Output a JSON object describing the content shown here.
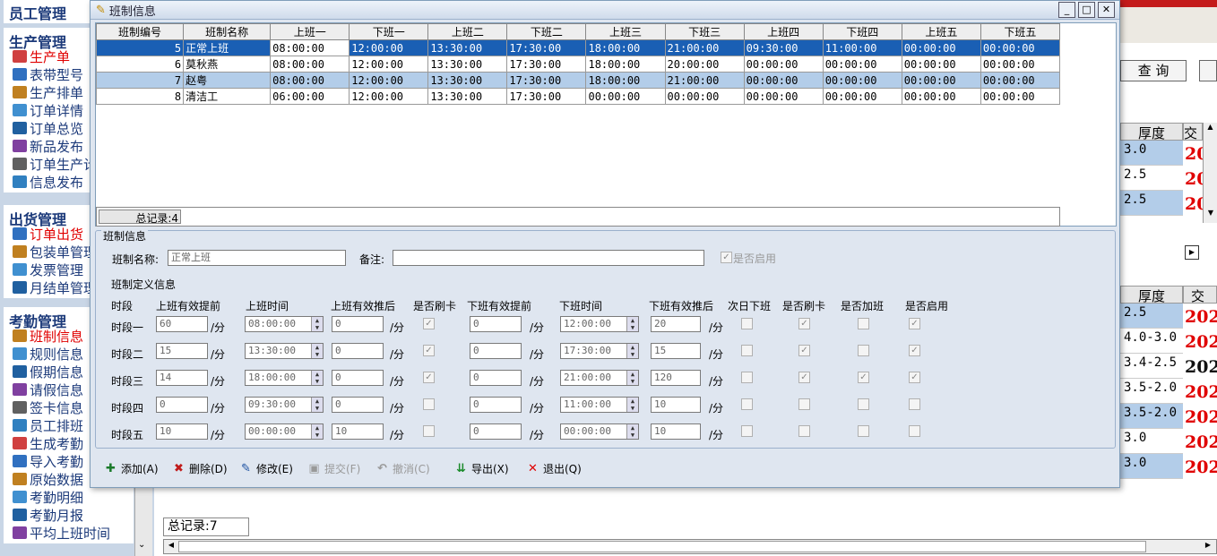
{
  "nav": {
    "top_header": "员工管理",
    "groups": [
      {
        "title": "生产管理",
        "items": [
          "生产单",
          "表带型号",
          "生产排单",
          "订单详情",
          "订单总览",
          "新品发布",
          "订单生产计",
          "信息发布"
        ]
      },
      {
        "title": "出货管理",
        "items": [
          "订单出货",
          "包装单管理",
          "发票管理",
          "月结单管理"
        ]
      },
      {
        "title": "考勤管理",
        "items": [
          "班制信息",
          "规则信息",
          "假期信息",
          "请假信息",
          "签卡信息",
          "员工排班",
          "生成考勤",
          "导入考勤",
          "原始数据",
          "考勤明细",
          "考勤月报",
          "平均上班时间"
        ]
      }
    ]
  },
  "background": {
    "query_button": "查 询",
    "col_thickness": "厚度",
    "col_next": "交",
    "table1": [
      "3.0",
      "2.5",
      "2.5"
    ],
    "table2": [
      "2.5",
      "4.0-3.0",
      "3.4-2.5",
      "3.5-2.0",
      "3.5-2.0",
      "3.0",
      "3.0"
    ],
    "year_prefix": "202",
    "total_records": "总记录:7"
  },
  "modal": {
    "title": "班制信息",
    "columns": [
      "班制编号",
      "班制名称",
      "上班一",
      "下班一",
      "上班二",
      "下班二",
      "上班三",
      "下班三",
      "上班四",
      "下班四",
      "上班五",
      "下班五"
    ],
    "rows": [
      [
        "5",
        "正常上班",
        "08:00:00",
        "12:00:00",
        "13:30:00",
        "17:30:00",
        "18:00:00",
        "21:00:00",
        "09:30:00",
        "11:00:00",
        "00:00:00",
        "00:00:00"
      ],
      [
        "6",
        "莫秋燕",
        "08:00:00",
        "12:00:00",
        "13:30:00",
        "17:30:00",
        "18:00:00",
        "20:00:00",
        "00:00:00",
        "00:00:00",
        "00:00:00",
        "00:00:00"
      ],
      [
        "7",
        "赵粤",
        "08:00:00",
        "12:00:00",
        "13:30:00",
        "17:30:00",
        "18:00:00",
        "21:00:00",
        "00:00:00",
        "00:00:00",
        "00:00:00",
        "00:00:00"
      ],
      [
        "8",
        "清洁工",
        "06:00:00",
        "12:00:00",
        "13:30:00",
        "17:30:00",
        "00:00:00",
        "00:00:00",
        "00:00:00",
        "00:00:00",
        "00:00:00",
        "00:00:00"
      ]
    ],
    "total_records": "总记录:4",
    "form": {
      "legend": "班制信息",
      "name_label": "班制名称:",
      "name_value": "正常上班",
      "remark_label": "备注:",
      "remark_value": "",
      "enabled_label": "是否启用",
      "def_title": "班制定义信息",
      "headers": [
        "时段",
        "上班有效提前",
        "上班时间",
        "上班有效推后",
        "是否刷卡",
        "下班有效提前",
        "下班时间",
        "下班有效推后",
        "次日下班",
        "是否刷卡",
        "是否加班",
        "是否启用"
      ],
      "unit": "/分",
      "segments": [
        {
          "label": "时段一",
          "on_early": "60",
          "on_time": "08:00:00",
          "on_late": "0",
          "on_card": true,
          "off_early": "0",
          "off_time": "12:00:00",
          "off_late": "20",
          "next_day": false,
          "off_card": true,
          "overtime": false,
          "enabled": true
        },
        {
          "label": "时段二",
          "on_early": "15",
          "on_time": "13:30:00",
          "on_late": "0",
          "on_card": true,
          "off_early": "0",
          "off_time": "17:30:00",
          "off_late": "15",
          "next_day": false,
          "off_card": true,
          "overtime": false,
          "enabled": true
        },
        {
          "label": "时段三",
          "on_early": "14",
          "on_time": "18:00:00",
          "on_late": "0",
          "on_card": true,
          "off_early": "0",
          "off_time": "21:00:00",
          "off_late": "120",
          "next_day": false,
          "off_card": true,
          "overtime": true,
          "enabled": true
        },
        {
          "label": "时段四",
          "on_early": "0",
          "on_time": "09:30:00",
          "on_late": "0",
          "on_card": false,
          "off_early": "0",
          "off_time": "11:00:00",
          "off_late": "10",
          "next_day": false,
          "off_card": false,
          "overtime": false,
          "enabled": false
        },
        {
          "label": "时段五",
          "on_early": "10",
          "on_time": "00:00:00",
          "on_late": "10",
          "on_card": false,
          "off_early": "0",
          "off_time": "00:00:00",
          "off_late": "10",
          "next_day": false,
          "off_card": false,
          "overtime": false,
          "enabled": false
        }
      ]
    },
    "toolbar": {
      "add": "添加(A)",
      "delete": "删除(D)",
      "edit": "修改(E)",
      "submit": "提交(F)",
      "cancel": "撤消(C)",
      "export": "导出(X)",
      "exit": "退出(Q)"
    }
  },
  "colors": {
    "accent": "#1a5fb4",
    "alt_row": "#b3cde9",
    "red": "#e00000"
  }
}
